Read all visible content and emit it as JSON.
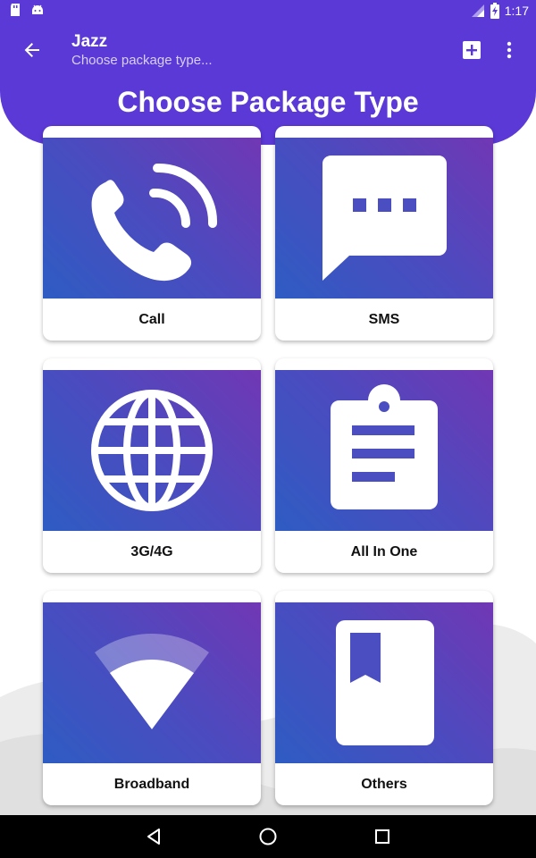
{
  "status_bar": {
    "time": "1:17",
    "left_icons": [
      "sd-card-icon",
      "android-icon"
    ],
    "right_icons": [
      "signal-icon",
      "battery-charging-icon"
    ]
  },
  "app_bar": {
    "title": "Jazz",
    "subtitle": "Choose package type...",
    "back_icon": "arrow-left-icon",
    "add_icon": "add-box-icon",
    "menu_icon": "more-vertical-icon"
  },
  "page": {
    "heading": "Choose Package Type"
  },
  "cards": [
    {
      "label": "Call",
      "icon": "phone-ringing-icon"
    },
    {
      "label": "SMS",
      "icon": "chat-bubble-icon"
    },
    {
      "label": "3G/4G",
      "icon": "globe-icon"
    },
    {
      "label": "All In One",
      "icon": "clipboard-icon"
    },
    {
      "label": "Broadband",
      "icon": "wifi-signal-icon"
    },
    {
      "label": "Others",
      "icon": "bookmark-book-icon"
    }
  ],
  "nav_bar": {
    "icons": [
      "back-triangle-icon",
      "home-circle-icon",
      "recents-square-icon"
    ]
  },
  "colors": {
    "primary": "#5b39d6",
    "gradient_start": "#2e5cc2",
    "gradient_end": "#7137b4"
  }
}
